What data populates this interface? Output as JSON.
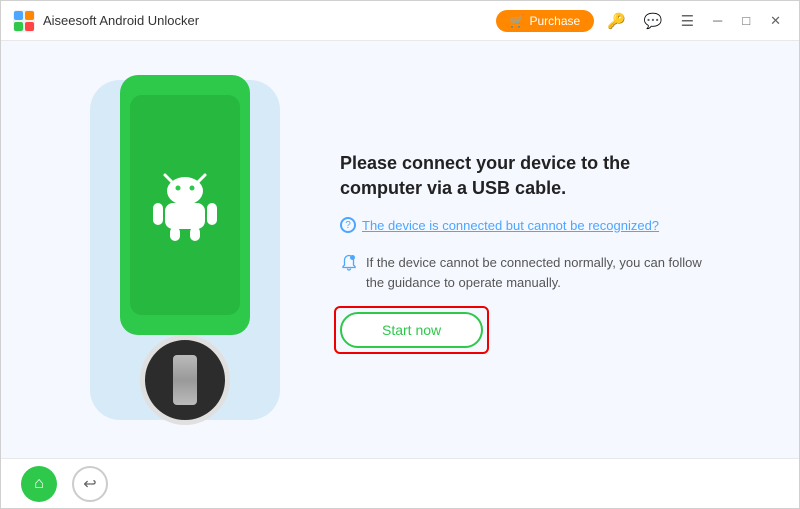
{
  "titlebar": {
    "logo_alt": "aiseesoft-logo",
    "title": "Aiseesoft Android Unlocker",
    "purchase_label": "Purchase",
    "icons": {
      "key": "🔑",
      "chat": "💬",
      "menu": "≡",
      "minimize": "—",
      "maximize": "□",
      "close": "✕"
    }
  },
  "main": {
    "heading": "Please connect your device to the\ncomputer via a USB cable.",
    "device_link": "The device is connected but cannot be recognized?",
    "guidance_text": "If the device cannot be connected normally, you can follow the guidance to operate manually.",
    "start_now_label": "Start now"
  },
  "bottom": {
    "home_icon": "⌂",
    "back_icon": "↩"
  }
}
